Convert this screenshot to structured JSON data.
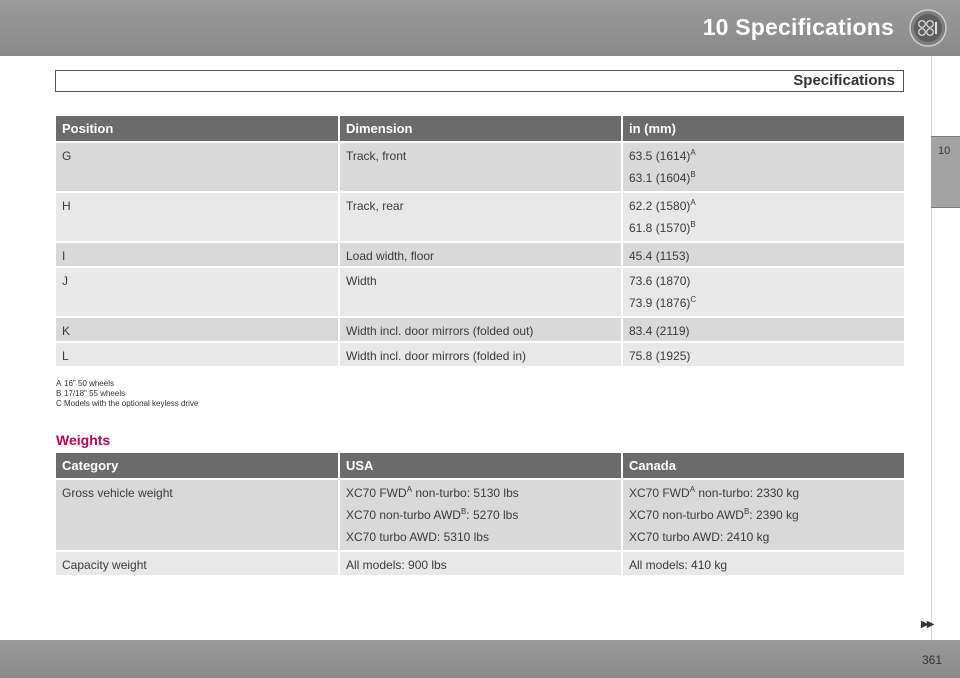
{
  "header": {
    "chapter_title": "10 Specifications",
    "icon": "gauges-icon"
  },
  "section": {
    "title": "Specifications"
  },
  "side_tab": {
    "label": "10"
  },
  "dimensions_table": {
    "headers": [
      "Position",
      "Dimension",
      "in (mm)"
    ],
    "rows": [
      {
        "position": "G",
        "dimension": "Track, front",
        "values": [
          {
            "text": "63.5 (1614)",
            "note": "A"
          },
          {
            "text": "63.1 (1604)",
            "note": "B"
          }
        ]
      },
      {
        "position": "H",
        "dimension": "Track, rear",
        "values": [
          {
            "text": "62.2 (1580)",
            "note": "A"
          },
          {
            "text": "61.8 (1570)",
            "note": "B"
          }
        ]
      },
      {
        "position": "I",
        "dimension": "Load width, floor",
        "values": [
          {
            "text": "45.4 (1153)",
            "note": ""
          }
        ]
      },
      {
        "position": "J",
        "dimension": "Width",
        "values": [
          {
            "text": "73.6 (1870)",
            "note": ""
          },
          {
            "text": "73.9 (1876)",
            "note": "C"
          }
        ]
      },
      {
        "position": "K",
        "dimension": "Width incl. door mirrors (folded out)",
        "values": [
          {
            "text": "83.4 (2119)",
            "note": ""
          }
        ]
      },
      {
        "position": "L",
        "dimension": "Width incl. door mirrors (folded in)",
        "values": [
          {
            "text": "75.8 (1925)",
            "note": ""
          }
        ]
      }
    ]
  },
  "footnotes": [
    {
      "mark": "A",
      "text": "16\" 50 wheels"
    },
    {
      "mark": "B",
      "text": "17/18\" 55 wheels"
    },
    {
      "mark": "C",
      "text": "Models with the optional keyless drive"
    }
  ],
  "weights": {
    "heading": "Weights",
    "headers": [
      "Category",
      "USA",
      "Canada"
    ],
    "rows": [
      {
        "category": "Gross vehicle weight",
        "usa": [
          {
            "pre": "XC70 FWD",
            "sup": "A",
            "post": " non-turbo: 5130 lbs"
          },
          {
            "pre": "XC70 non-turbo AWD",
            "sup": "B",
            "post": ": 5270 lbs"
          },
          {
            "pre": "XC70 turbo AWD: 5310 lbs",
            "sup": "",
            "post": ""
          }
        ],
        "canada": [
          {
            "pre": "XC70 FWD",
            "sup": "A",
            "post": " non-turbo: 2330 kg"
          },
          {
            "pre": "XC70 non-turbo AWD",
            "sup": "B",
            "post": ": 2390 kg"
          },
          {
            "pre": "XC70 turbo AWD: 2410 kg",
            "sup": "",
            "post": ""
          }
        ]
      },
      {
        "category": "Capacity weight",
        "usa": [
          {
            "pre": "All models: 900 lbs",
            "sup": "",
            "post": ""
          }
        ],
        "canada": [
          {
            "pre": "All models: 410 kg",
            "sup": "",
            "post": ""
          }
        ]
      }
    ]
  },
  "footer": {
    "page_number": "361",
    "next_arrows": "▶▶"
  }
}
